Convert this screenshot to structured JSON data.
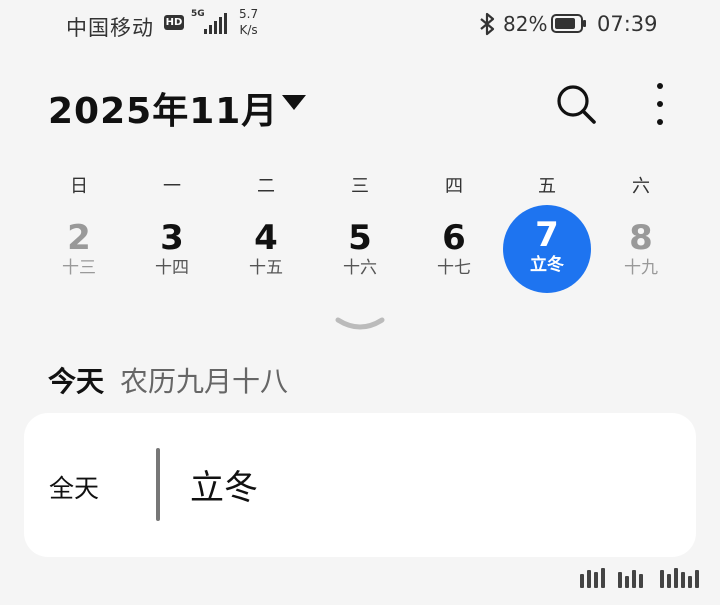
{
  "status_bar": {
    "carrier": "中国移动",
    "hd_badge": "HD",
    "network": "5G",
    "speed_value": "5.7",
    "speed_unit": "K/s",
    "battery_percent": "82%",
    "time": "07:39",
    "icons": [
      "hd-icon",
      "signal-icon",
      "bluetooth-icon",
      "battery-icon"
    ]
  },
  "header": {
    "title": "2025年11月",
    "icons": [
      "dropdown-caret-icon",
      "search-icon",
      "more-vertical-icon"
    ]
  },
  "week": {
    "weekday_labels": [
      "日",
      "一",
      "二",
      "三",
      "四",
      "五",
      "六"
    ],
    "days": [
      {
        "num": "2",
        "lunar": "十三",
        "muted": true
      },
      {
        "num": "3",
        "lunar": "十四"
      },
      {
        "num": "4",
        "lunar": "十五"
      },
      {
        "num": "5",
        "lunar": "十六"
      },
      {
        "num": "6",
        "lunar": "十七"
      },
      {
        "num": "7",
        "lunar": "立冬",
        "selected": true
      },
      {
        "num": "8",
        "lunar": "十九",
        "muted": true
      }
    ],
    "accent_color": "#1e74f0"
  },
  "today": {
    "label": "今天",
    "lunar_date": "农历九月十八"
  },
  "event": {
    "time_label": "全天",
    "title": "立冬"
  }
}
